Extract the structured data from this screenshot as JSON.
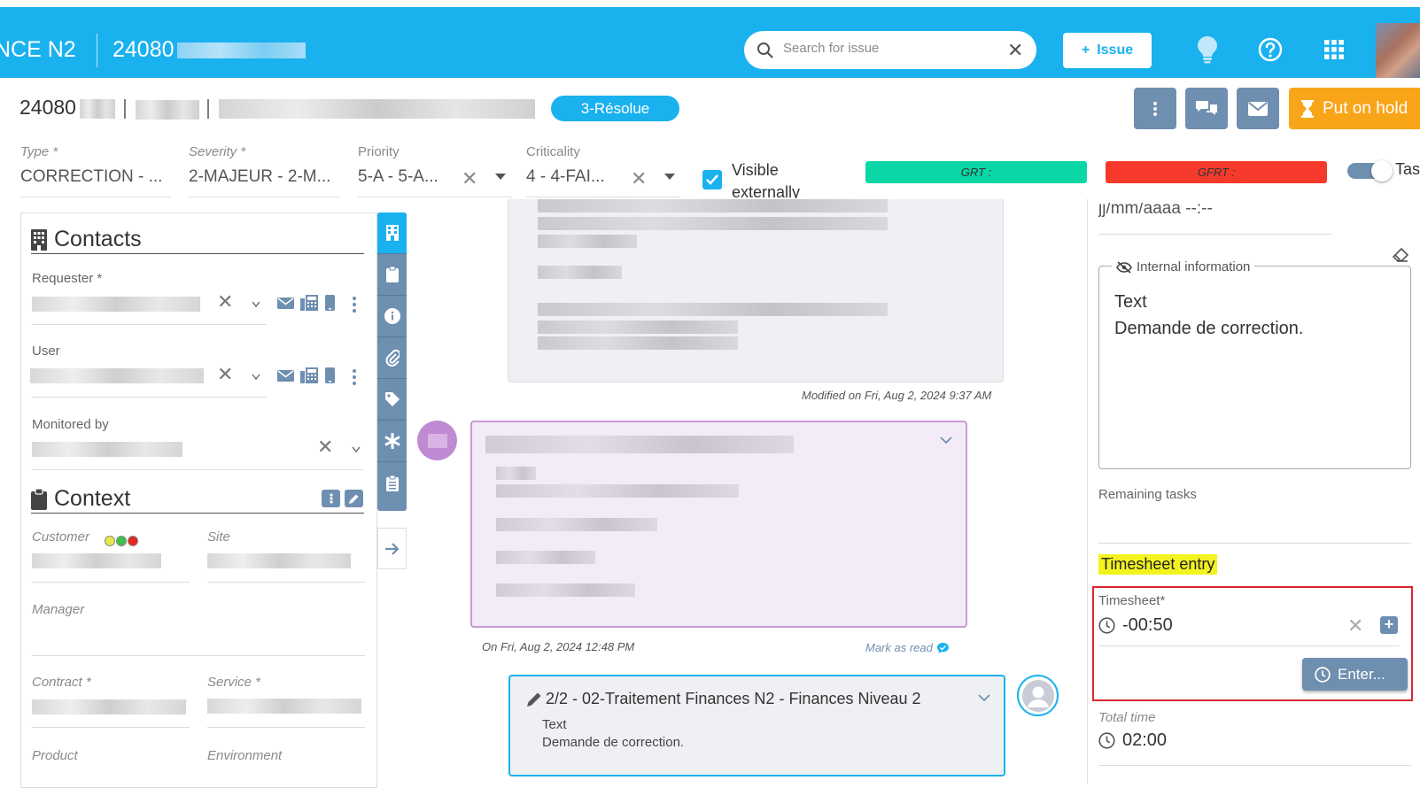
{
  "topbar": {
    "app_title": "NCE N2",
    "issue_ref": "24080",
    "search_placeholder": "Search for issue",
    "issue_button": "Issue"
  },
  "header": {
    "issue_id": "24080",
    "status": "3-Résolue",
    "hold_button": "Put on hold"
  },
  "fields": {
    "type": {
      "label": "Type *",
      "value": "CORRECTION - ..."
    },
    "severity": {
      "label": "Severity *",
      "value": "2-MAJEUR - 2-M..."
    },
    "priority": {
      "label": "Priority",
      "value": "5-A - 5-A..."
    },
    "criticality": {
      "label": "Criticality",
      "value": "4 - 4-FAI..."
    },
    "visible_externally": "Visible externally",
    "grt": "GRT :",
    "gfrt": "GFRT :",
    "task": "Task"
  },
  "contacts": {
    "title": "Contacts",
    "requester": "Requester *",
    "user": "User",
    "monitored_by": "Monitored by"
  },
  "context": {
    "title": "Context",
    "customer": "Customer",
    "site": "Site",
    "manager": "Manager",
    "contract": "Contract *",
    "service": "Service *",
    "product": "Product",
    "environment": "Environment"
  },
  "conversation": {
    "modified_note": "Modified on Fri, Aug 2, 2024 9:37 AM",
    "msg2_date": "On Fri, Aug 2, 2024 12:48 PM",
    "mark_as_read": "Mark as read",
    "msg3_title": "2/2 - 02-Traitement Finances N2 - Finances Niveau 2",
    "msg3_line1": "Text",
    "msg3_line2": "Demande de correction."
  },
  "right_panel": {
    "date_fragment": "jj/mm/aaaa --:--",
    "internal_info_label": "Internal information",
    "internal_text_line1": "Text",
    "internal_text_line2": "Demande de correction.",
    "remaining_tasks": "Remaining tasks",
    "timesheet_entry": "Timesheet entry",
    "timesheet_label": "Timesheet*",
    "timesheet_value": "-00:50",
    "enter_button": "Enter...",
    "total_time_label": "Total time",
    "total_time_value": "02:00"
  },
  "colors": {
    "primary": "#1ab1ef",
    "slate": "#6f8fb0",
    "hold": "#f9a51a",
    "grt_bar": "#0ad6a6",
    "gfrt_bar": "#f53a2c",
    "highlight": "#f3f31f",
    "red_box": "#d9262e"
  },
  "customer_lights": [
    "#e8e84a",
    "#3cc24a",
    "#e62424"
  ]
}
